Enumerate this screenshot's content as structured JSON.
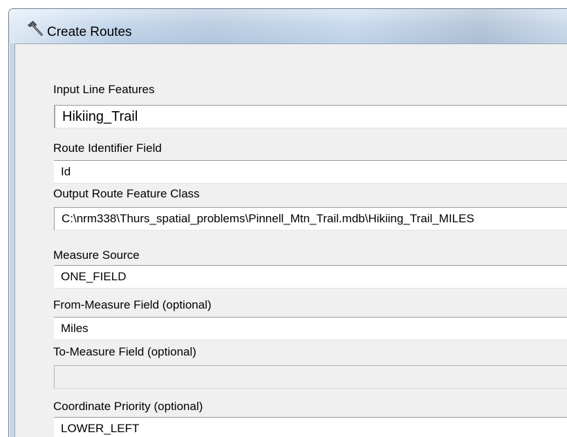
{
  "window": {
    "title": "Create Routes",
    "icon": "hammer-icon"
  },
  "fields": [
    {
      "label": "Input Line Features",
      "value": "Hikiing_Trail"
    },
    {
      "label": "Route Identifier Field",
      "value": "Id"
    },
    {
      "label": "Output Route Feature Class",
      "value": "C:\\nrm338\\Thurs_spatial_problems\\Pinnell_Mtn_Trail.mdb\\Hikiing_Trail_MILES"
    },
    {
      "label": "Measure Source",
      "value": "ONE_FIELD"
    },
    {
      "label": "From-Measure Field (optional)",
      "value": "Miles"
    },
    {
      "label": "To-Measure Field (optional)",
      "value": ""
    },
    {
      "label": "Coordinate Priority (optional)",
      "value": "LOWER_LEFT"
    }
  ]
}
